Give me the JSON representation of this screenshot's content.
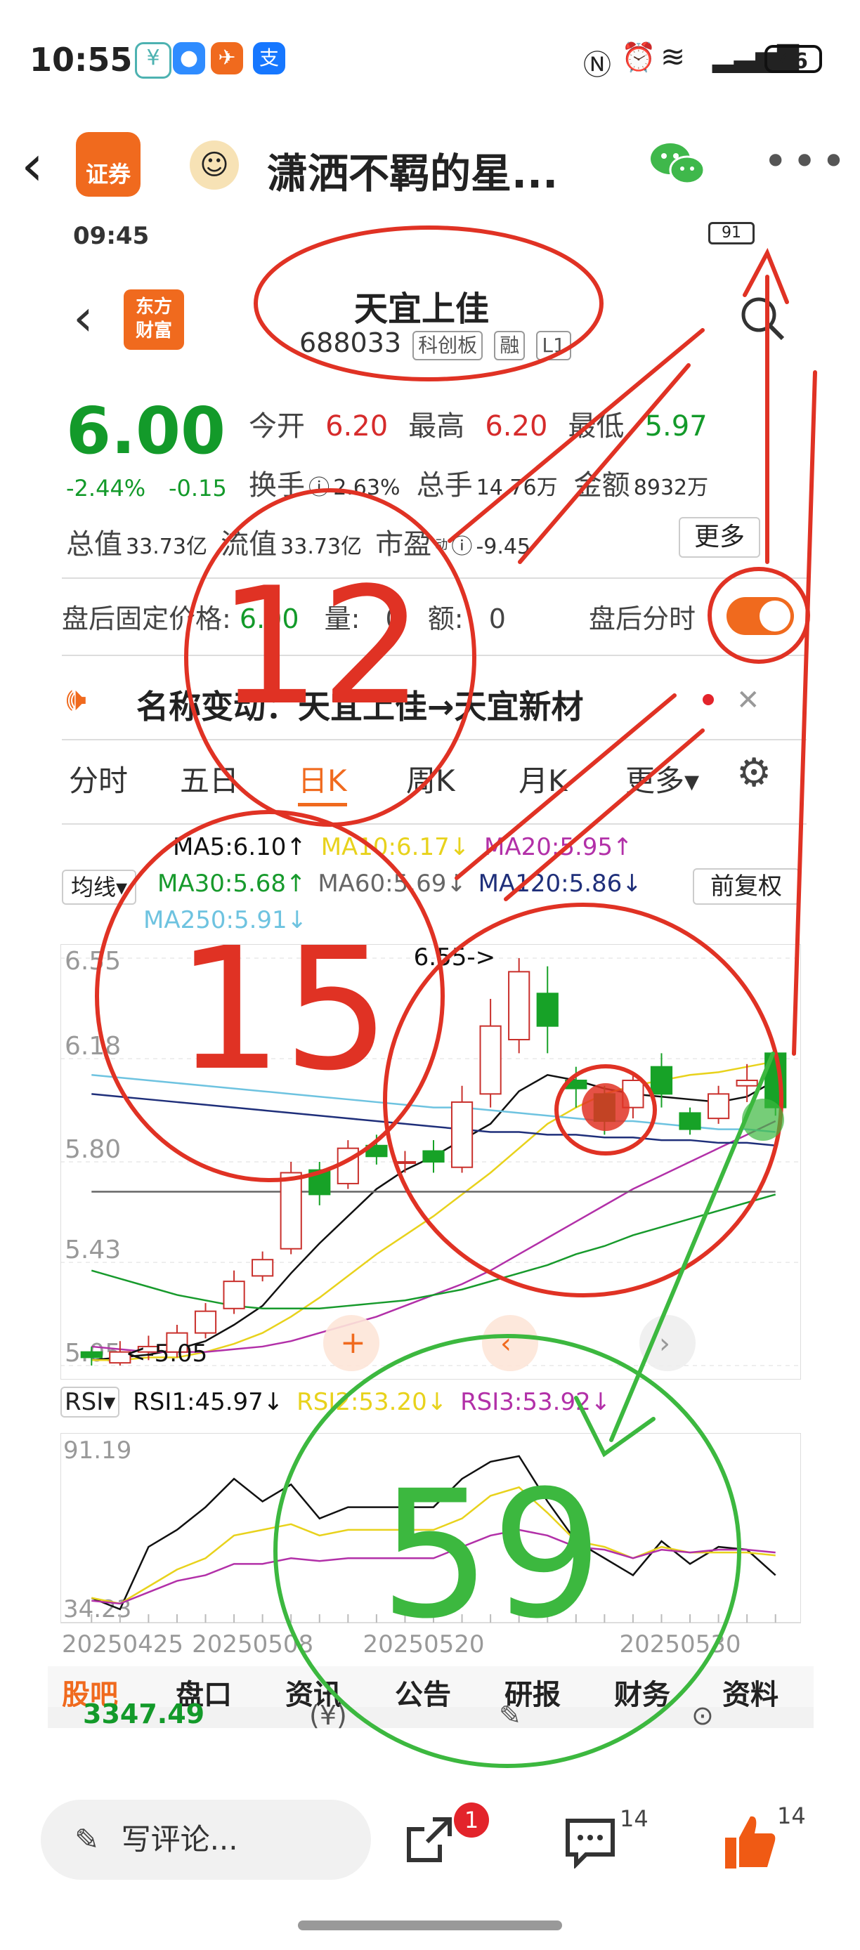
{
  "status_bar": {
    "time": "10:55",
    "battery": "46"
  },
  "nav": {
    "back_icon": "back-chevron-icon",
    "app_logo_text": "证券",
    "title": "潇洒不羁的星..."
  },
  "stock": {
    "name": "天宜上佳",
    "code": "688033",
    "board": "科创板",
    "margin": "融",
    "level": "L1",
    "inner_time": "09:45",
    "inner_battery": "91",
    "price": "6.00",
    "change_pct": "-2.44%",
    "change": "-0.15",
    "open_label": "今开",
    "open": "6.20",
    "high_label": "最高",
    "high": "6.20",
    "low_label": "最低",
    "low": "5.97",
    "turnover_label": "换手",
    "turnover": "2.63%",
    "volume_label": "总手",
    "volume": "14.76万",
    "amount_label": "金额",
    "amount": "8932万",
    "total_cap_label": "总值",
    "total_cap": "33.73亿",
    "float_cap_label": "流值",
    "float_cap": "33.73亿",
    "pe_label": "市盈",
    "pe_sub": "动",
    "pe": "-9.45",
    "more_button": "更多"
  },
  "after_hours": {
    "label": "盘后固定价格:",
    "price": "6.00",
    "vol_label": "量:",
    "vol": "0",
    "amt_label": "额:",
    "amt": "0",
    "toggle_label": "盘后分时"
  },
  "notice": {
    "text": "名称变动：天宜上佳→天宜新材",
    "close": "✕"
  },
  "tabs": [
    "分时",
    "五日",
    "日K",
    "周K",
    "月K",
    "更多▾"
  ],
  "active_tab": "日K",
  "ma": {
    "ma5": "MA5:6.10↑",
    "ma10": "MA10:6.17↓",
    "ma20": "MA20:5.95↑",
    "ma30": "MA30:5.68↑",
    "ma60": "MA60:5.69↓",
    "ma120": "MA120:5.86↓",
    "ma250": "MA250:5.91↓",
    "selector": "均线▾",
    "adjust": "前复权"
  },
  "chart_data": [
    {
      "type": "candlestick",
      "title": "",
      "yticks": [
        "6.55",
        "6.18",
        "5.80",
        "5.43",
        "5.05"
      ],
      "ylim": [
        5.05,
        6.55
      ],
      "max_label": "6.55->",
      "min_label": "<-5.05",
      "candles": [
        {
          "o": 5.1,
          "c": 5.08,
          "h": 5.12,
          "l": 5.05
        },
        {
          "o": 5.06,
          "c": 5.1,
          "h": 5.14,
          "l": 5.05
        },
        {
          "o": 5.1,
          "c": 5.12,
          "h": 5.16,
          "l": 5.07
        },
        {
          "o": 5.1,
          "c": 5.17,
          "h": 5.2,
          "l": 5.08
        },
        {
          "o": 5.17,
          "c": 5.25,
          "h": 5.28,
          "l": 5.15
        },
        {
          "o": 5.26,
          "c": 5.36,
          "h": 5.4,
          "l": 5.24
        },
        {
          "o": 5.38,
          "c": 5.44,
          "h": 5.47,
          "l": 5.36
        },
        {
          "o": 5.48,
          "c": 5.76,
          "h": 5.8,
          "l": 5.46
        },
        {
          "o": 5.77,
          "c": 5.68,
          "h": 5.8,
          "l": 5.64
        },
        {
          "o": 5.72,
          "c": 5.85,
          "h": 5.88,
          "l": 5.7
        },
        {
          "o": 5.86,
          "c": 5.82,
          "h": 5.9,
          "l": 5.79
        },
        {
          "o": 5.8,
          "c": 5.8,
          "h": 5.84,
          "l": 5.76
        },
        {
          "o": 5.84,
          "c": 5.8,
          "h": 5.88,
          "l": 5.76
        },
        {
          "o": 5.78,
          "c": 6.02,
          "h": 6.08,
          "l": 5.76
        },
        {
          "o": 6.05,
          "c": 6.3,
          "h": 6.4,
          "l": 6.0
        },
        {
          "o": 6.25,
          "c": 6.5,
          "h": 6.55,
          "l": 6.2
        },
        {
          "o": 6.42,
          "c": 6.3,
          "h": 6.52,
          "l": 6.2
        },
        {
          "o": 6.1,
          "c": 6.07,
          "h": 6.15,
          "l": 6.0
        },
        {
          "o": 6.05,
          "c": 5.95,
          "h": 6.08,
          "l": 5.9
        },
        {
          "o": 6.0,
          "c": 6.1,
          "h": 6.12,
          "l": 5.96
        },
        {
          "o": 6.15,
          "c": 6.05,
          "h": 6.2,
          "l": 6.0
        },
        {
          "o": 5.98,
          "c": 5.92,
          "h": 6.0,
          "l": 5.9
        },
        {
          "o": 5.96,
          "c": 6.05,
          "h": 6.08,
          "l": 5.94
        },
        {
          "o": 6.08,
          "c": 6.1,
          "h": 6.16,
          "l": 6.02
        },
        {
          "o": 6.2,
          "c": 6.0,
          "h": 6.2,
          "l": 5.97
        }
      ],
      "series": [
        {
          "name": "MA5",
          "color": "#111111",
          "values": [
            5.07,
            5.08,
            5.09,
            5.11,
            5.14,
            5.2,
            5.27,
            5.39,
            5.5,
            5.6,
            5.7,
            5.77,
            5.82,
            5.88,
            5.94,
            6.06,
            6.12,
            6.1,
            6.07,
            6.05,
            6.04,
            6.03,
            6.02,
            6.04,
            6.1
          ]
        },
        {
          "name": "MA10",
          "color": "#e8d21c",
          "values": [
            5.07,
            5.07,
            5.08,
            5.08,
            5.1,
            5.13,
            5.17,
            5.23,
            5.3,
            5.38,
            5.46,
            5.53,
            5.6,
            5.68,
            5.76,
            5.85,
            5.94,
            6.0,
            6.05,
            6.08,
            6.1,
            6.12,
            6.13,
            6.15,
            6.17
          ]
        },
        {
          "name": "MA20",
          "color": "#b230a8",
          "values": [
            5.12,
            5.11,
            5.1,
            5.1,
            5.1,
            5.11,
            5.12,
            5.14,
            5.17,
            5.2,
            5.23,
            5.27,
            5.31,
            5.35,
            5.4,
            5.46,
            5.52,
            5.58,
            5.64,
            5.7,
            5.75,
            5.8,
            5.85,
            5.9,
            5.95
          ]
        },
        {
          "name": "MA30",
          "color": "#179a2c",
          "values": [
            5.4,
            5.37,
            5.34,
            5.31,
            5.29,
            5.27,
            5.26,
            5.26,
            5.26,
            5.27,
            5.28,
            5.29,
            5.31,
            5.33,
            5.36,
            5.39,
            5.42,
            5.46,
            5.49,
            5.53,
            5.56,
            5.59,
            5.62,
            5.65,
            5.68
          ]
        },
        {
          "name": "MA60",
          "color": "#666666",
          "values": [
            5.69,
            5.69,
            5.69,
            5.69,
            5.69,
            5.69,
            5.69,
            5.69,
            5.69,
            5.69,
            5.69,
            5.69,
            5.69,
            5.69,
            5.69,
            5.69,
            5.69,
            5.69,
            5.69,
            5.69,
            5.69,
            5.69,
            5.69,
            5.69,
            5.69
          ]
        },
        {
          "name": "MA120",
          "color": "#1f2f7a",
          "values": [
            6.05,
            6.04,
            6.03,
            6.02,
            6.01,
            6.0,
            5.99,
            5.98,
            5.97,
            5.96,
            5.95,
            5.94,
            5.93,
            5.92,
            5.91,
            5.91,
            5.9,
            5.9,
            5.89,
            5.89,
            5.88,
            5.88,
            5.87,
            5.87,
            5.86
          ]
        },
        {
          "name": "MA250",
          "color": "#6ec3e0",
          "values": [
            6.12,
            6.11,
            6.1,
            6.09,
            6.08,
            6.07,
            6.06,
            6.05,
            6.04,
            6.03,
            6.02,
            6.01,
            6.0,
            6.0,
            5.99,
            5.98,
            5.97,
            5.96,
            5.95,
            5.95,
            5.94,
            5.93,
            5.92,
            5.92,
            5.91
          ]
        }
      ]
    },
    {
      "type": "line",
      "title": "",
      "yticks": [
        "91.19",
        "34.23"
      ],
      "ylim": [
        34.23,
        91.19
      ],
      "xticks": [
        "20250425",
        "20250508",
        "20250520",
        "20250530"
      ],
      "series": [
        {
          "name": "RSI1",
          "color": "#111111",
          "values": [
            38,
            34,
            56,
            62,
            70,
            80,
            72,
            78,
            66,
            70,
            70,
            70,
            70,
            80,
            86,
            88,
            72,
            58,
            52,
            46,
            58,
            50,
            56,
            55,
            46
          ]
        },
        {
          "name": "RSI2",
          "color": "#e8d21c",
          "values": [
            38,
            36,
            42,
            48,
            52,
            60,
            62,
            64,
            60,
            62,
            62,
            62,
            62,
            66,
            74,
            77,
            68,
            58,
            56,
            52,
            56,
            54,
            54,
            54,
            53
          ]
        },
        {
          "name": "RSI3",
          "color": "#b230a8",
          "values": [
            37,
            36,
            40,
            44,
            46,
            50,
            50,
            52,
            51,
            52,
            52,
            52,
            52,
            56,
            60,
            62,
            60,
            56,
            55,
            52,
            55,
            54,
            55,
            55,
            54
          ]
        }
      ]
    }
  ],
  "rsi_labels": {
    "selector": "RSI▾",
    "rsi1": "RSI1:45.97↓",
    "rsi2": "RSI2:53.20↓",
    "rsi3": "RSI3:53.92↓"
  },
  "lower_tabs": [
    "股吧",
    "盘口",
    "资讯",
    "公告",
    "研报",
    "财务",
    "资料"
  ],
  "index_value": "3347.49",
  "annotations": {
    "a1": "12",
    "a2": "15",
    "a3": "59"
  },
  "bottom": {
    "comment_placeholder": "写评论...",
    "share_badge": "1",
    "comment_count": "14",
    "like_count": "14"
  }
}
